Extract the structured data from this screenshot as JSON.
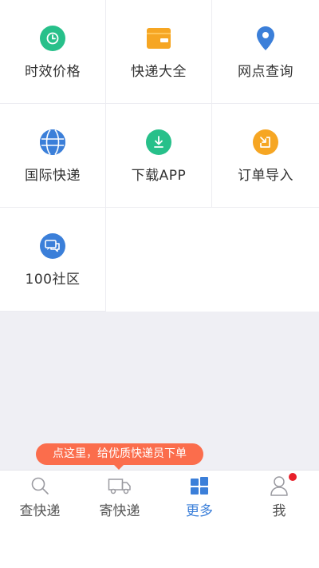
{
  "colors": {
    "green": "#27c08a",
    "orange": "#f6a623",
    "blue": "#3b7fd9",
    "tooltip": "#fb6d4c",
    "badge": "#e8202a",
    "background_gray": "#efeff4"
  },
  "grid": {
    "items": [
      {
        "label": "时效价格",
        "icon": "clock-icon"
      },
      {
        "label": "快递大全",
        "icon": "wallet-icon"
      },
      {
        "label": "网点查询",
        "icon": "location-pin-icon"
      },
      {
        "label": "国际快递",
        "icon": "globe-icon"
      },
      {
        "label": "下载APP",
        "icon": "download-icon"
      },
      {
        "label": "订单导入",
        "icon": "import-icon"
      },
      {
        "label": "100社区",
        "icon": "chat-bubbles-icon"
      }
    ]
  },
  "tooltip": {
    "text": "点这里，给优质快递员下单"
  },
  "tabbar": {
    "items": [
      {
        "label": "查快递",
        "icon": "search-icon"
      },
      {
        "label": "寄快递",
        "icon": "truck-icon"
      },
      {
        "label": "更多",
        "icon": "grid-tiles-icon",
        "active": true
      },
      {
        "label": "我",
        "icon": "person-icon",
        "badge": true
      }
    ]
  }
}
